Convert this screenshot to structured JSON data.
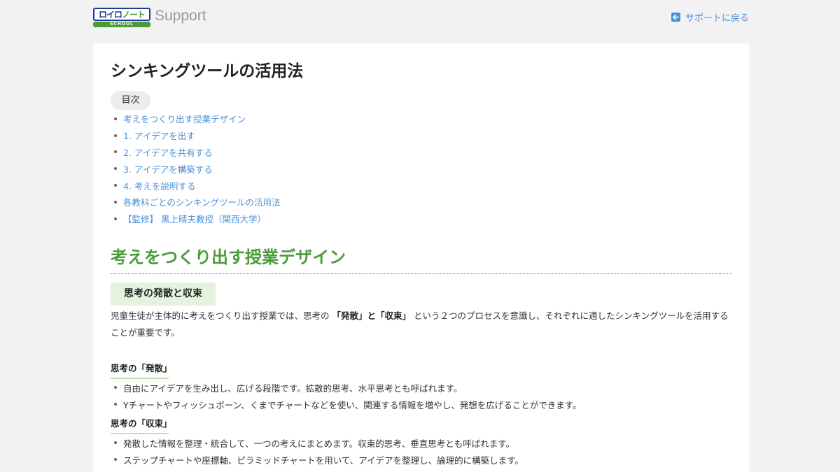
{
  "header": {
    "logo_text_a": "ロイロ",
    "logo_text_b": "ノート",
    "logo_sub": "SCHOOL",
    "brand": "Support",
    "back_label": "サポートに戻る"
  },
  "article": {
    "title": "シンキングツールの活用法",
    "toc_label": "目次",
    "toc": [
      "考えをつくり出す授業デザイン",
      "1. アイデアを出す",
      "2. アイデアを共有する",
      "3. アイデアを構築する",
      "4. 考えを説明する",
      "各教科ごとのシンキングツールの活用法",
      "【監修】 黒上晴夫教授（関西大学）"
    ],
    "section_title": "考えをつくり出す授業デザイン",
    "subsection_title": "思考の発散と収束",
    "para_pre": "児童生徒が主体的に考えをつくり出す授業では、思考の",
    "para_bold": "「発散」と「収束」",
    "para_post": "という２つのプロセスを意識し、それぞれに適したシンキングツールを活用することが重要です。",
    "divergence": {
      "heading": "思考の「発散」",
      "items": [
        "自由にアイデアを生み出し、広げる段階です。拡散的思考、水平思考とも呼ばれます。",
        "Yチャートやフィッシュボーン、くまでチャートなどを使い、関連する情報を増やし、発想を広げることができます。"
      ]
    },
    "convergence": {
      "heading": "思考の「収束」",
      "items": [
        "発散した情報を整理・統合して、一つの考えにまとめます。収束的思考、垂直思考とも呼ばれます。",
        "ステップチャートや座標軸、ピラミッドチャートを用いて、アイデアを整理し、論理的に構築します。"
      ]
    }
  },
  "colors": {
    "accent_green": "#4c9b3b",
    "link_blue": "#4a90d9",
    "logo_navy": "#1c3f94"
  },
  "icons": {
    "back": "arrow-left-icon"
  }
}
